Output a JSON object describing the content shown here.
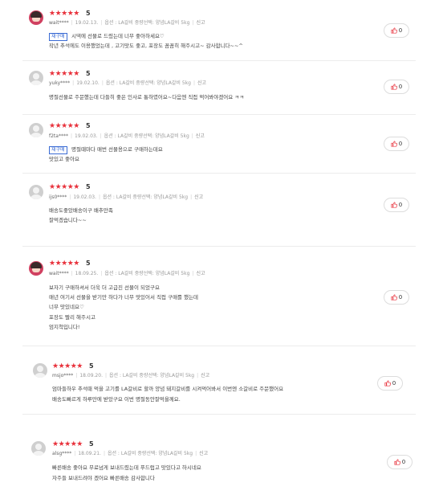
{
  "reviews": [
    {
      "avatar": "photo",
      "stars": "★★★★★",
      "score": "5",
      "nickname": "wait****",
      "date": "19.02.13.",
      "option": "옵션 : LA갈비 중량선택: 양념LA갈비 5kg",
      "report": "신고",
      "badge": "재구매",
      "lines": [
        "시댁에 선물로 드렸는데  너무 좋아하세요♡",
        "작년 추석에도 이용했었는데 , 고기맛도 좋고, 포장도 꼼꼼히 해주시고~ 감사합니다~~^"
      ],
      "likes": "0"
    },
    {
      "avatar": "default",
      "stars": "★★★★★",
      "score": "5",
      "nickname": "yuky****",
      "date": "19.02.10.",
      "option": "옵션 : LA갈비 중량선택: 양념LA갈비 5kg",
      "report": "신고",
      "lines": [
        "명절선물로 주문했는데 다들히 좋은 인사로 통하였어요~다음엔 직접 먹어봐야겠어요 ㅋㅋ"
      ],
      "likes": "0"
    },
    {
      "avatar": "default",
      "stars": "★★★★★",
      "score": "5",
      "nickname": "f2ta****",
      "date": "19.02.03.",
      "option": "옵션 : LA갈비 중량선택: 양념LA갈비 5kg",
      "report": "신고",
      "badge": "재구매",
      "lines": [
        "명절때마다 매번 선물용으로 구매하는데요",
        "맛있고 좋아요"
      ],
      "likes": "0"
    },
    {
      "avatar": "default",
      "stars": "★★★★★",
      "score": "5",
      "nickname": "ijs0****",
      "date": "19.02.03.",
      "option": "옵션 : LA갈비 중량선택: 양념LA갈비 5kg",
      "report": "신고",
      "lines": [
        "배송도좋았배송이구 배추만족",
        "잘먹겠습니다~~"
      ],
      "likes": "0"
    },
    {
      "avatar": "photo",
      "stars": "★★★★★",
      "score": "5",
      "nickname": "wait****",
      "date": "18.09.25.",
      "option": "옵션 : LA갈비 중량선택: 양념LA갈비 5kg",
      "report": "신고",
      "lines": [
        "보자기 구매하셔서 더욱 더 고급진 선물이 되었구요",
        "매년 여기서 선물을 받기만 하다가 너무 맛있어서 직접 구매를 했는데",
        "너무 맛있네요♡",
        "포장도 빨리 해주시고",
        "엄지척입니다!"
      ],
      "likes": "0"
    },
    {
      "avatar": "default",
      "stars": "★★★★★",
      "score": "5",
      "nickname": "msjo****",
      "date": "18.09.20.",
      "option": "옵션 : LA갈비 중량선택: 양념LA갈비 5kg",
      "report": "신고",
      "lines": [
        "엄마들하우 추석때 먹을 고기를 LA갈비로 할까 양념 돼지갈비를 시켜먹어봐서 이번엔 소갈비로 주문했어요",
        "배송도빠르게 하루만에 받았구요 이번 명절동안잘먹을께요."
      ],
      "likes": "0"
    },
    {
      "avatar": "default",
      "stars": "★★★★★",
      "score": "5",
      "nickname": "alsg****",
      "date": "18.09.21.",
      "option": "옵션 : LA갈비 중량선택: 양념LA갈비 5kg",
      "report": "신고",
      "lines": [
        "빠른배송 좋아요 무료넘게 보내드렸는데 푸드럽고 맛있다고 하시네요",
        "자주들 보내드려야 겠어요 빠른배송 감사합니다"
      ],
      "likes": "0"
    }
  ]
}
